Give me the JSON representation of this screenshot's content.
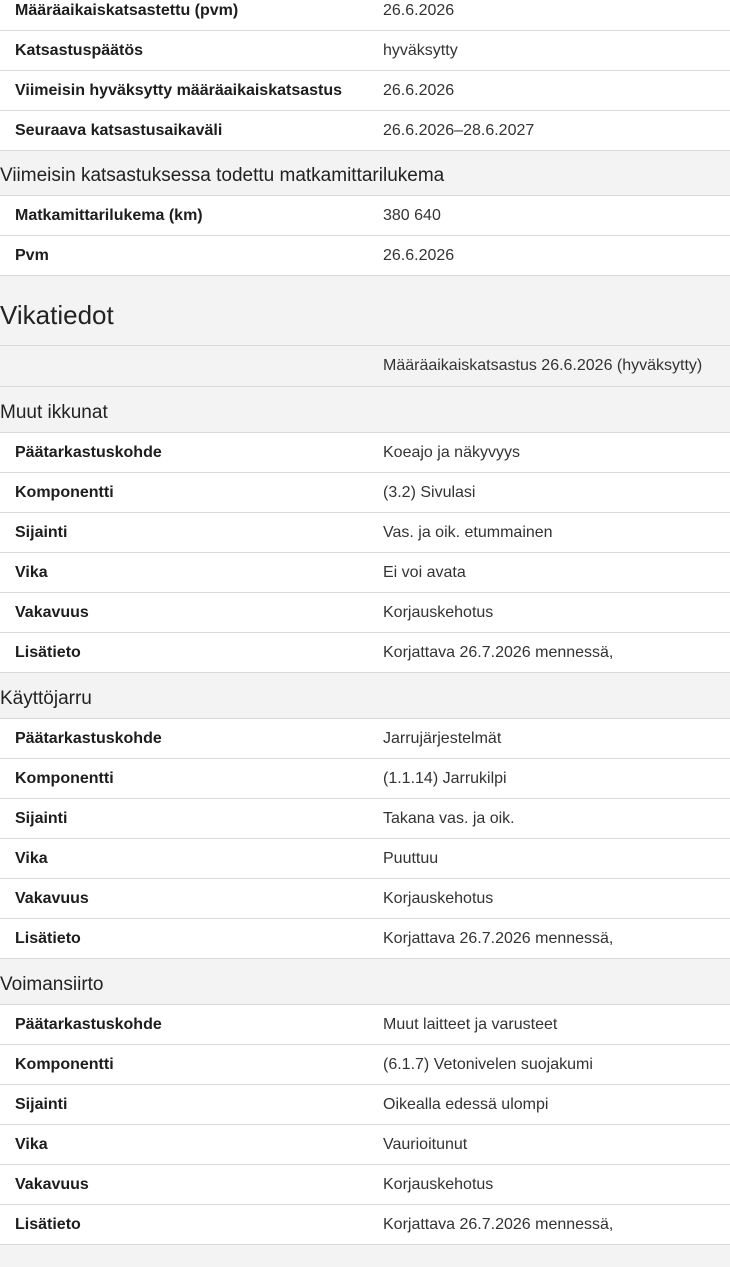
{
  "inspection_top": [
    {
      "label": "Määräaikaiskatsastettu (pvm)",
      "value": "26.6.2026"
    },
    {
      "label": "Katsastuspäätös",
      "value": "hyväksytty"
    },
    {
      "label": "Viimeisin hyväksytty määräaikaiskatsastus",
      "value": "26.6.2026"
    },
    {
      "label": "Seuraava katsastusaikaväli",
      "value": "26.6.2026–28.6.2027"
    }
  ],
  "odometer": {
    "title": "Viimeisin katsastuksessa todettu matkamittarilukema",
    "rows": [
      {
        "label": "Matkamittarilukema (km)",
        "value": "380 640"
      },
      {
        "label": "Pvm",
        "value": "26.6.2026"
      }
    ]
  },
  "faults": {
    "heading": "Vikatiedot",
    "inspection_label": "Määräaikaiskatsastus 26.6.2026 (hyväksytty)",
    "groups": [
      {
        "title": "Muut ikkunat",
        "rows": [
          {
            "label": "Päätarkastuskohde",
            "value": "Koeajo ja näkyvyys"
          },
          {
            "label": "Komponentti",
            "value": "(3.2) Sivulasi"
          },
          {
            "label": "Sijainti",
            "value": "Vas. ja oik. etummainen"
          },
          {
            "label": "Vika",
            "value": "Ei voi avata"
          },
          {
            "label": "Vakavuus",
            "value": "Korjauskehotus"
          },
          {
            "label": "Lisätieto",
            "value": "Korjattava 26.7.2026 mennessä,"
          }
        ]
      },
      {
        "title": "Käyttöjarru",
        "rows": [
          {
            "label": "Päätarkastuskohde",
            "value": "Jarrujärjestelmät"
          },
          {
            "label": "Komponentti",
            "value": "(1.1.14) Jarrukilpi"
          },
          {
            "label": "Sijainti",
            "value": "Takana vas. ja oik."
          },
          {
            "label": "Vika",
            "value": "Puuttuu"
          },
          {
            "label": "Vakavuus",
            "value": "Korjauskehotus"
          },
          {
            "label": "Lisätieto",
            "value": "Korjattava 26.7.2026 mennessä,"
          }
        ]
      },
      {
        "title": "Voimansiirto",
        "rows": [
          {
            "label": "Päätarkastuskohde",
            "value": "Muut laitteet ja varusteet"
          },
          {
            "label": "Komponentti",
            "value": "(6.1.7) Vetonivelen suojakumi"
          },
          {
            "label": "Sijainti",
            "value": "Oikealla edessä ulompi"
          },
          {
            "label": "Vika",
            "value": "Vaurioitunut"
          },
          {
            "label": "Vakavuus",
            "value": "Korjauskehotus"
          },
          {
            "label": "Lisätieto",
            "value": "Korjattava 26.7.2026 mennessä,"
          }
        ]
      }
    ]
  }
}
